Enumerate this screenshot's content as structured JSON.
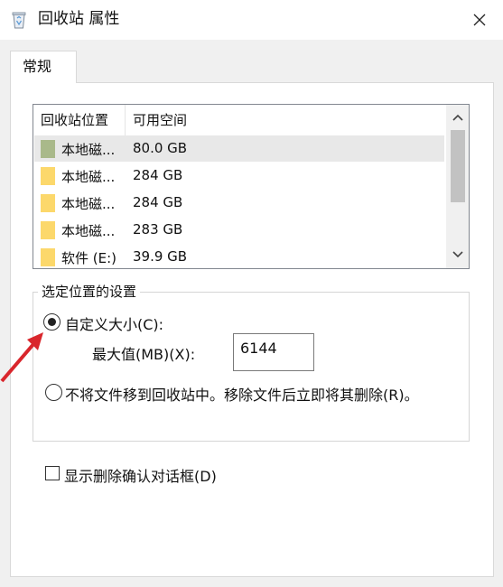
{
  "window": {
    "title": "回收站 属性",
    "icon": "recycle-bin-icon",
    "close_icon": "close-icon"
  },
  "tabs": [
    {
      "label": "常规",
      "selected": true
    }
  ],
  "locations": {
    "columns": [
      "回收站位置",
      "可用空间"
    ],
    "rows": [
      {
        "name": "本地磁...",
        "space": "80.0 GB",
        "icon": "drive-icon-green",
        "selected": true
      },
      {
        "name": "本地磁...",
        "space": "284 GB",
        "icon": "folder-icon",
        "selected": false
      },
      {
        "name": "本地磁...",
        "space": "284 GB",
        "icon": "folder-icon",
        "selected": false
      },
      {
        "name": "本地磁...",
        "space": "283 GB",
        "icon": "folder-icon",
        "selected": false
      },
      {
        "name": "软件 (E:)",
        "space": "39.9 GB",
        "icon": "folder-icon",
        "selected": false
      }
    ]
  },
  "settings": {
    "group_label": "选定位置的设置",
    "custom_size_label": "自定义大小(C):",
    "custom_size_selected": true,
    "max_size_label": "最大值(MB)(X):",
    "max_size_value": "6144",
    "no_recycle_label": "不将文件移到回收站中。移除文件后立即将其删除(R)。",
    "no_recycle_selected": false
  },
  "confirm_dialog": {
    "label": "显示删除确认对话框(D)",
    "checked": false
  },
  "colors": {
    "annotation_arrow": "#d9262c",
    "drive_green": "#a9b98a",
    "folder_yellow": "#fcd86b"
  }
}
